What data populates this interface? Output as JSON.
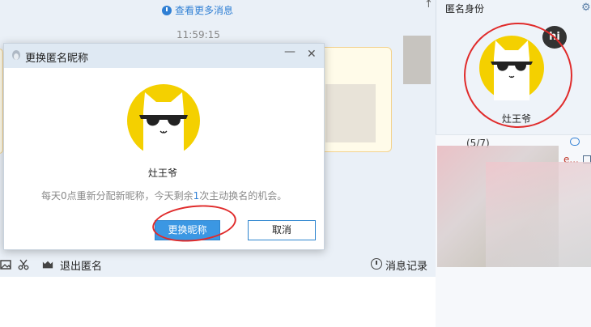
{
  "chat": {
    "more_messages_link": "查看更多消息",
    "timestamp": "11:59:15"
  },
  "toolbar": {
    "exit_anonymous": "退出匿名",
    "message_history": "消息记录"
  },
  "right_panel": {
    "title": "匿名身份",
    "nickname": "灶王爷",
    "member_count": "(5/7)",
    "hi_badge": "hi",
    "more_text": "e..."
  },
  "dialog": {
    "title": "更换匿名昵称",
    "nickname": "灶王爷",
    "note_before": "每天0点重新分配新昵称，今天剩余",
    "note_count": "1",
    "note_after": "次主动换名的机会。",
    "change_button": "更换昵称",
    "cancel_button": "取消",
    "minimize_glyph": "—",
    "close_glyph": "✕"
  },
  "colors": {
    "accent": "#3b97e3",
    "avatar_yellow": "#f4d000",
    "annotation_red": "#e02b2b",
    "link_blue": "#2f7fd4"
  }
}
